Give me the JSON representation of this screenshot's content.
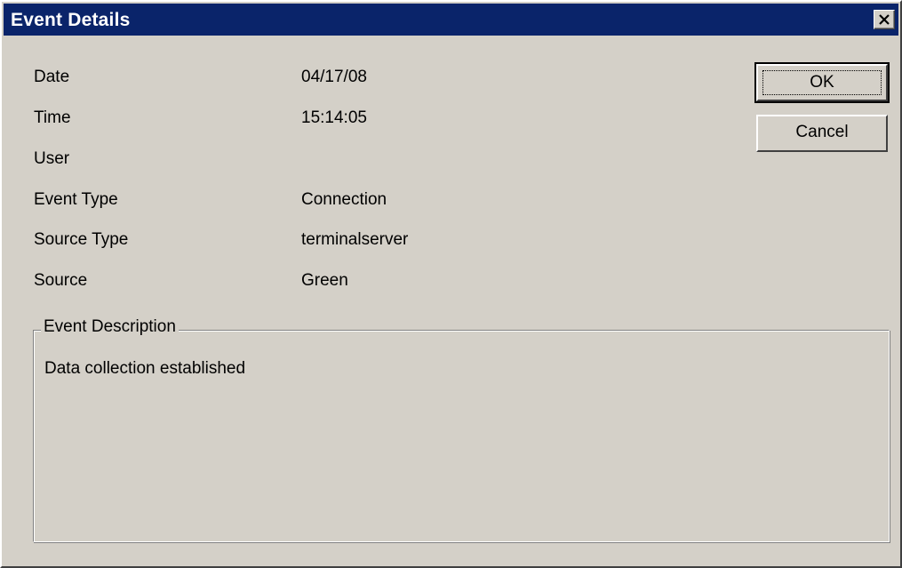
{
  "window": {
    "title": "Event Details",
    "close_symbol": "✕"
  },
  "fields": {
    "date_label": "Date",
    "date_value": "04/17/08",
    "time_label": "Time",
    "time_value": "15:14:05",
    "user_label": "User",
    "user_value": "",
    "event_type_label": "Event Type",
    "event_type_value": "Connection",
    "source_type_label": "Source Type",
    "source_type_value": "terminalserver",
    "source_label": "Source",
    "source_value": "Green"
  },
  "buttons": {
    "ok_label": "OK",
    "cancel_label": "Cancel"
  },
  "description": {
    "legend": "Event Description",
    "text": "Data collection established"
  },
  "colors": {
    "titlebar": "#0a246a",
    "dialog_face": "#d4d0c8"
  },
  "icons": {
    "close": "close-icon"
  }
}
